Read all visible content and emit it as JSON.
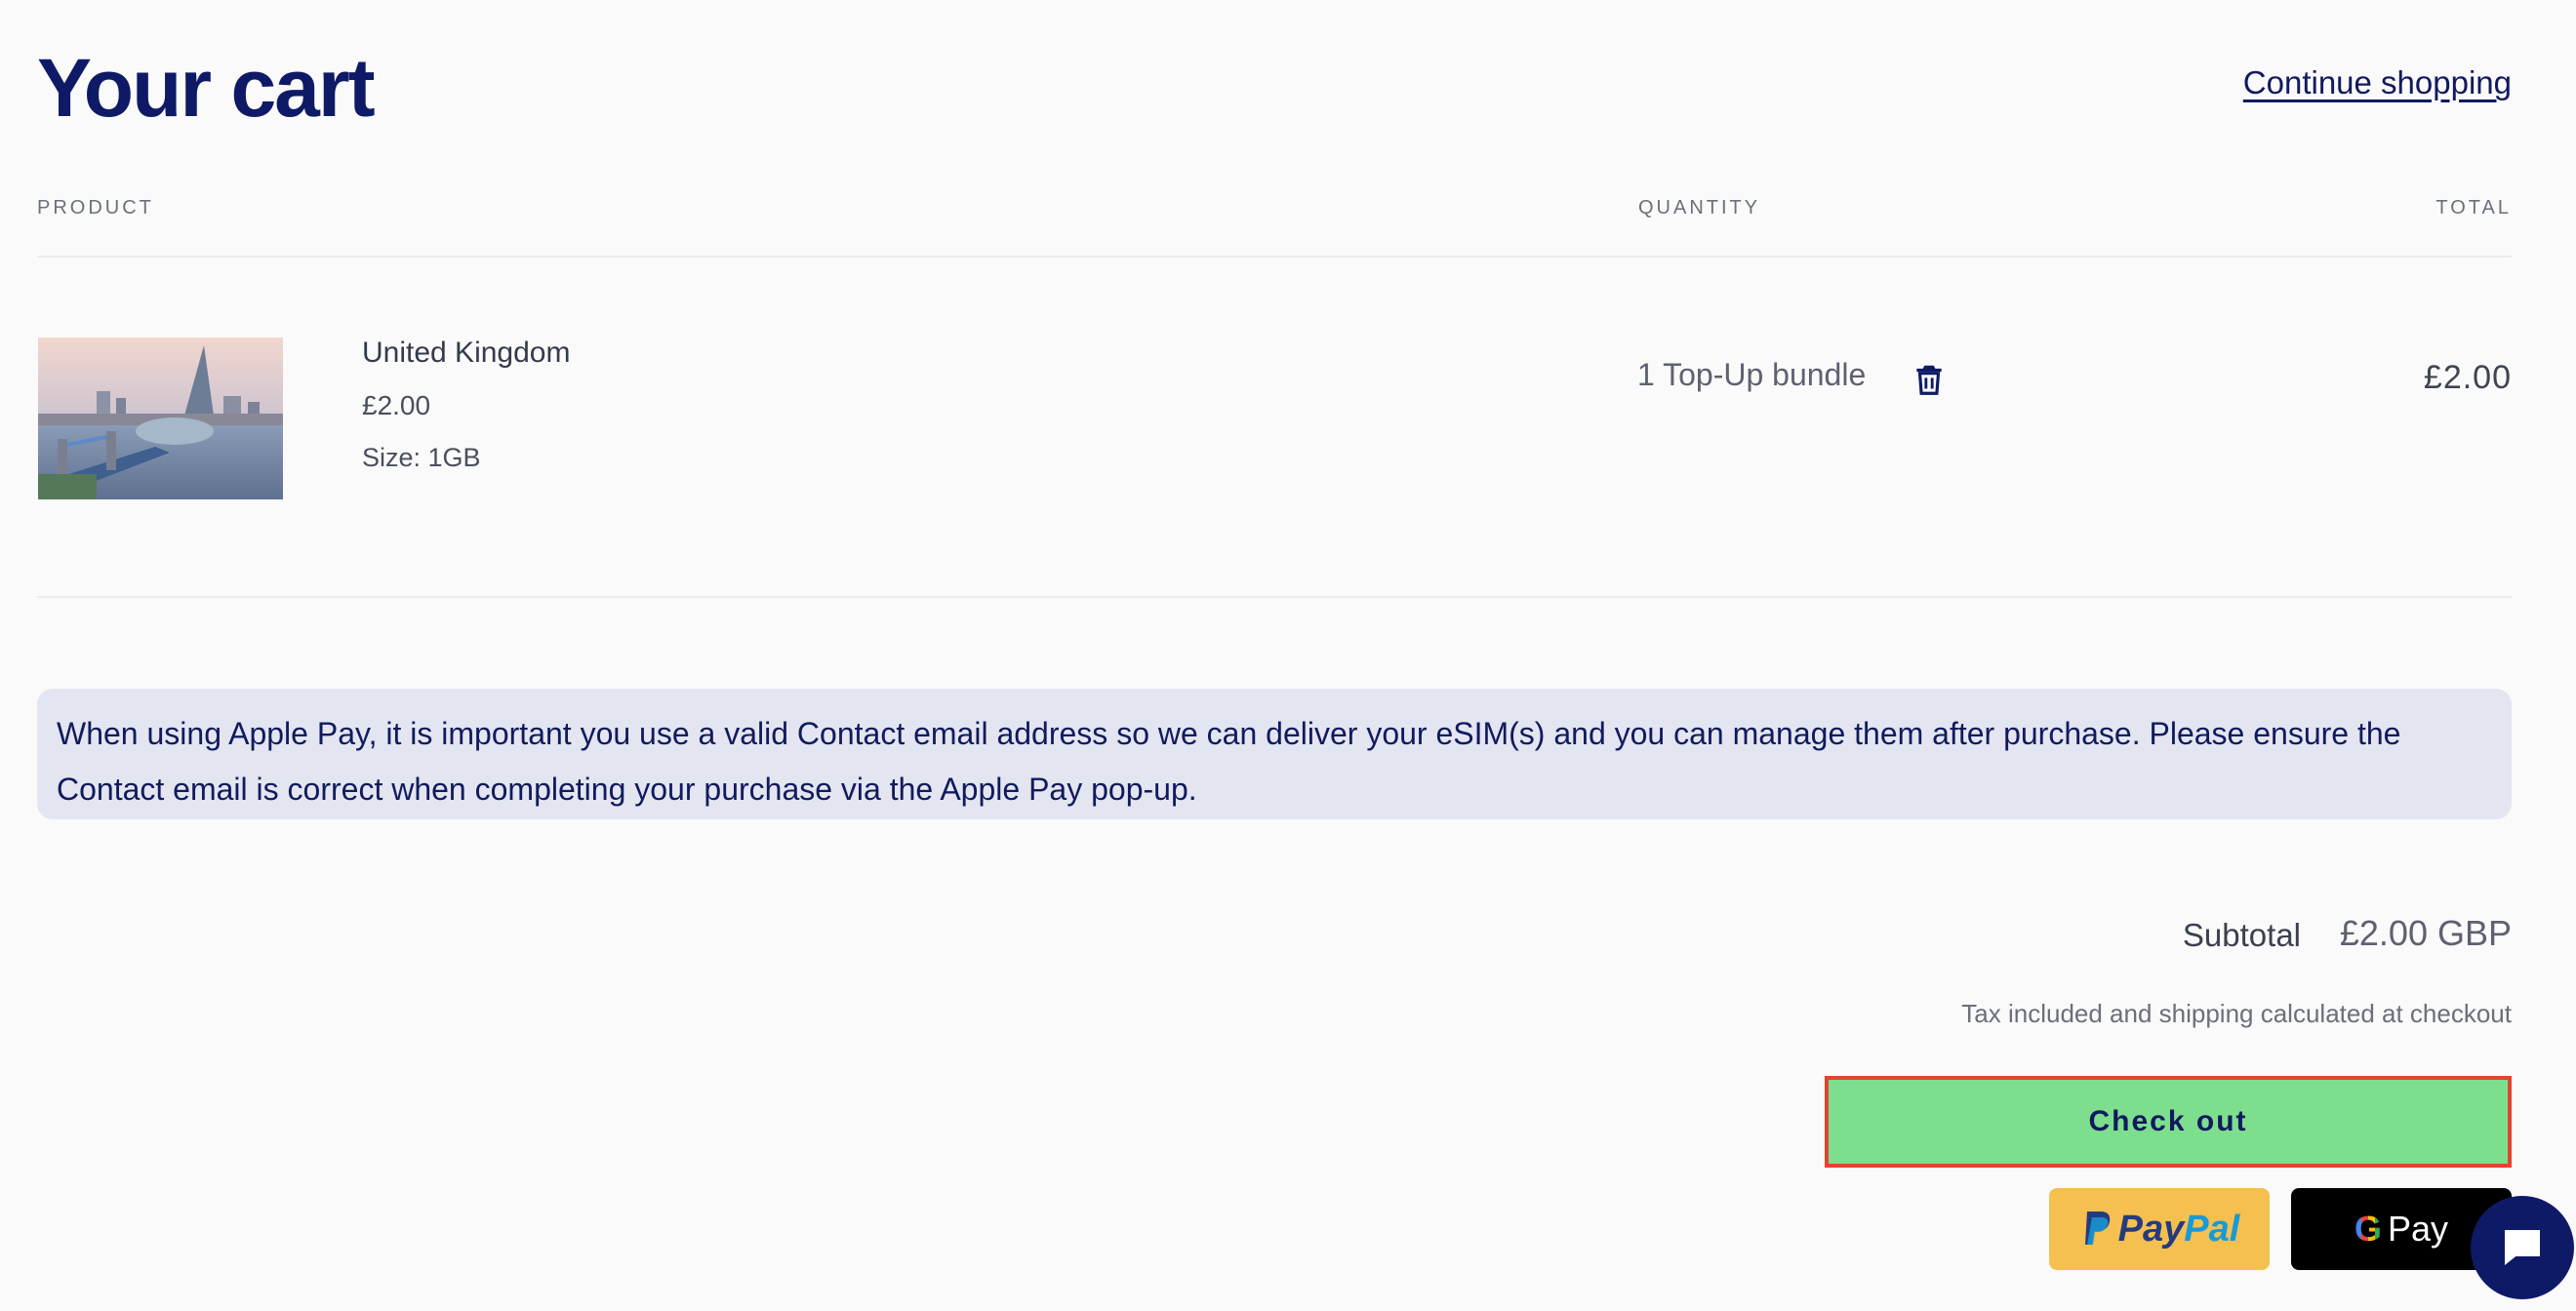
{
  "header": {
    "title": "Your cart",
    "continue_link": "Continue shopping"
  },
  "columns": {
    "product": "PRODUCT",
    "quantity": "QUANTITY",
    "total": "TOTAL"
  },
  "cart_item": {
    "name": "United Kingdom",
    "price": "£2.00",
    "size": "Size: 1GB",
    "quantity_text": "1 Top-Up bundle",
    "total": "£2.00",
    "image_icon": "london-skyline-image",
    "remove_icon": "trash-icon"
  },
  "notice": {
    "text": "When using Apple Pay, it is important you use a valid Contact email address so we can deliver your eSIM(s) and you can manage them after purchase. Please ensure the Contact email is correct when completing your purchase via the Apple Pay pop-up."
  },
  "summary": {
    "subtotal_label": "Subtotal",
    "subtotal_value": "£2.00 GBP",
    "tax_note": "Tax included and shipping calculated at checkout"
  },
  "actions": {
    "checkout_label": "Check out",
    "paypal_pay": "Pay",
    "paypal_pal": "Pal",
    "gpay_label": "Pay",
    "gpay_g": "G"
  },
  "colors": {
    "brand_navy": "#0f1a66",
    "checkout_green": "#7ddf8e",
    "checkout_border": "#e0452e",
    "paypal_yellow": "#f5c04f",
    "notice_bg": "#e3e6f0"
  },
  "chat": {
    "icon": "chat-bubble-icon"
  }
}
